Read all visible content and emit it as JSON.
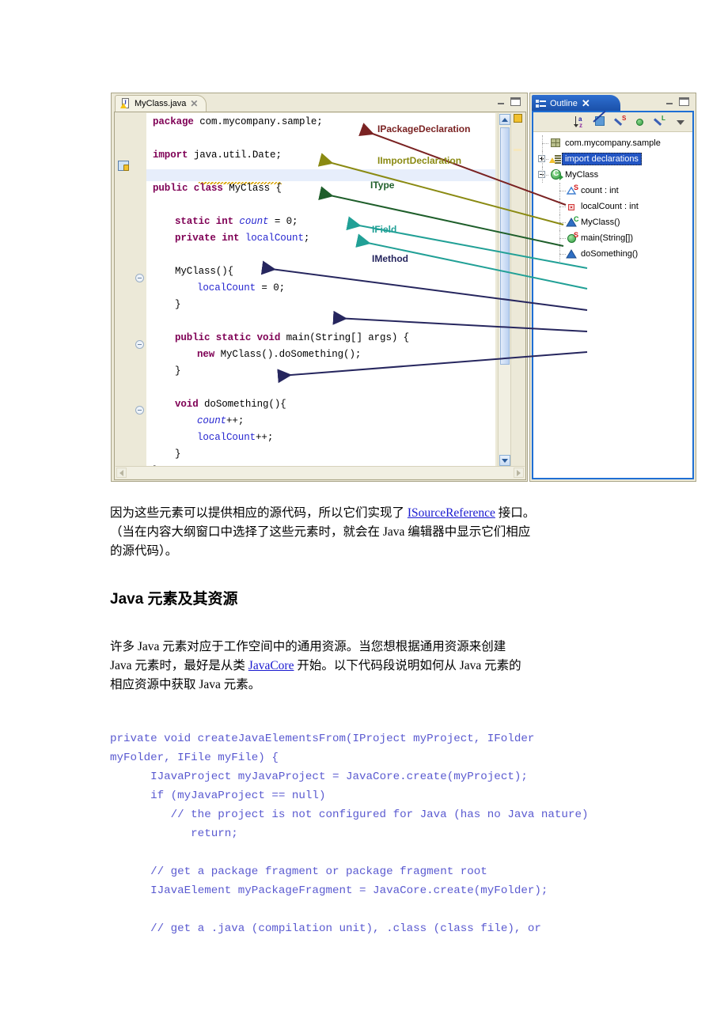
{
  "figure": {
    "editor": {
      "tab_label": "MyClass.java",
      "file_icon": "java-file-icon",
      "close_icon": "close-icon",
      "minimize_icon": "minimize-icon",
      "maximize_icon": "maximize-icon",
      "code_lines": [
        {
          "indent": 0,
          "segments": [
            {
              "t": "package",
              "c": "kw"
            },
            {
              "t": " com.mycompany.sample;",
              "c": "plain"
            }
          ]
        },
        {
          "indent": 0,
          "segments": []
        },
        {
          "indent": 0,
          "segments": [
            {
              "t": "import",
              "c": "kw"
            },
            {
              "t": " java.util.Date;",
              "c": "plain"
            }
          ]
        },
        {
          "indent": 0,
          "segments": []
        },
        {
          "indent": 0,
          "segments": [
            {
              "t": "public class",
              "c": "kw"
            },
            {
              "t": " MyClass {",
              "c": "plain"
            }
          ]
        },
        {
          "indent": 0,
          "segments": []
        },
        {
          "indent": 1,
          "segments": [
            {
              "t": "static int",
              "c": "kw"
            },
            {
              "t": " ",
              "c": "plain"
            },
            {
              "t": "count",
              "c": "fldi"
            },
            {
              "t": " = 0;",
              "c": "plain"
            }
          ]
        },
        {
          "indent": 1,
          "segments": [
            {
              "t": "private int",
              "c": "kw"
            },
            {
              "t": " ",
              "c": "plain"
            },
            {
              "t": "localCount",
              "c": "fld"
            },
            {
              "t": ";",
              "c": "plain"
            }
          ]
        },
        {
          "indent": 0,
          "segments": []
        },
        {
          "indent": 1,
          "segments": [
            {
              "t": "MyClass(){",
              "c": "plain"
            }
          ]
        },
        {
          "indent": 2,
          "segments": [
            {
              "t": "localCount",
              "c": "fld"
            },
            {
              "t": " = 0;",
              "c": "plain"
            }
          ]
        },
        {
          "indent": 1,
          "segments": [
            {
              "t": "}",
              "c": "plain"
            }
          ]
        },
        {
          "indent": 0,
          "segments": []
        },
        {
          "indent": 1,
          "segments": [
            {
              "t": "public static void",
              "c": "kw"
            },
            {
              "t": " main(String[] args) {",
              "c": "plain"
            }
          ]
        },
        {
          "indent": 2,
          "segments": [
            {
              "t": "new",
              "c": "kw"
            },
            {
              "t": " MyClass().doSomething();",
              "c": "plain"
            }
          ]
        },
        {
          "indent": 1,
          "segments": [
            {
              "t": "}",
              "c": "plain"
            }
          ]
        },
        {
          "indent": 0,
          "segments": []
        },
        {
          "indent": 1,
          "segments": [
            {
              "t": "void",
              "c": "kw"
            },
            {
              "t": " doSomething(){",
              "c": "plain"
            }
          ]
        },
        {
          "indent": 2,
          "segments": [
            {
              "t": "count",
              "c": "fldi"
            },
            {
              "t": "++;",
              "c": "plain"
            }
          ]
        },
        {
          "indent": 2,
          "segments": [
            {
              "t": "localCount",
              "c": "fld"
            },
            {
              "t": "++;",
              "c": "plain"
            }
          ]
        },
        {
          "indent": 1,
          "segments": [
            {
              "t": "}",
              "c": "plain"
            }
          ]
        },
        {
          "indent": 0,
          "segments": [
            {
              "t": "}",
              "c": "plain"
            }
          ]
        }
      ]
    },
    "outline": {
      "tab_label": "Outline",
      "close_icon": "close-icon",
      "minimize_icon": "minimize-icon",
      "maximize_icon": "maximize-icon",
      "toolbar_icons": [
        "sort-alphabetically-icon",
        "hide-fields-icon",
        "hide-static-members-icon",
        "hide-non-public-members-icon",
        "hide-local-types-icon",
        "view-menu-icon"
      ],
      "tree": [
        {
          "label": "com.mycompany.sample",
          "icon": "package-icon",
          "depth": 0,
          "expander": "none",
          "selected": false
        },
        {
          "label": "import declarations",
          "icon": "import-declarations-icon",
          "depth": 0,
          "expander": "plus",
          "selected": true
        },
        {
          "label": "MyClass",
          "icon": "class-icon",
          "depth": 0,
          "expander": "minus",
          "selected": false
        },
        {
          "label": "count : int",
          "icon": "field-public-static-icon",
          "depth": 1,
          "expander": "none",
          "selected": false,
          "badge": "S",
          "badge_color": "red"
        },
        {
          "label": "localCount : int",
          "icon": "field-private-icon",
          "depth": 1,
          "expander": "none",
          "selected": false
        },
        {
          "label": "MyClass()",
          "icon": "constructor-icon",
          "depth": 1,
          "expander": "none",
          "selected": false,
          "badge": "C",
          "badge_color": "green"
        },
        {
          "label": "main(String[])",
          "icon": "method-public-static-icon",
          "depth": 1,
          "expander": "none",
          "selected": false,
          "badge": "S",
          "badge_color": "red"
        },
        {
          "label": "doSomething()",
          "icon": "method-default-icon",
          "depth": 1,
          "expander": "none",
          "selected": false
        }
      ]
    },
    "annotations": [
      {
        "label": "IPackageDeclaration",
        "color": "#7a2222"
      },
      {
        "label": "IImportDeclaration",
        "color": "#8a8a12"
      },
      {
        "label": "IType",
        "color": "#1e5e2a"
      },
      {
        "label": "IField",
        "color": "#1f9a93"
      },
      {
        "label": "IMethod",
        "color": "#26265e"
      }
    ]
  },
  "document": {
    "paragraph1_part1": "因为这些元素可以提供相应的源代码，所以它们实现了 ",
    "paragraph1_link": "ISourceReference",
    "paragraph1_part2": " 接口。",
    "paragraph1_line2": "（当在内容大纲窗口中选择了这些元素时，就会在 Java 编辑器中显示它们相应",
    "paragraph1_line3": "的源代码）。",
    "heading": "Java 元素及其资源",
    "paragraph2_line1": "许多 Java 元素对应于工作空间中的通用资源。当您想根据通用资源来创建",
    "paragraph2_line2_part1": "Java 元素时，最好是从类 ",
    "paragraph2_link": "JavaCore",
    "paragraph2_line2_part2": " 开始。以下代码段说明如何从 Java 元素的",
    "paragraph2_line3": "相应资源中获取 Java 元素。",
    "code_snippet": "private void createJavaElementsFrom(IProject myProject, IFolder\nmyFolder, IFile myFile) {\n      IJavaProject myJavaProject = JavaCore.create(myProject);\n      if (myJavaProject == null)\n         // the project is not configured for Java (has no Java nature)\n            return;\n\n      // get a package fragment or package fragment root\n      IJavaElement myPackageFragment = JavaCore.create(myFolder);\n\n      // get a .java (compilation unit), .class (class file), or"
  },
  "colors": {
    "keyword": "#7f0055",
    "field": "#2727d0",
    "link": "#1a1ad0",
    "selection": "#2255c4",
    "window_chrome": "#ece9d8",
    "outline_tab": "#1f6fd4"
  }
}
